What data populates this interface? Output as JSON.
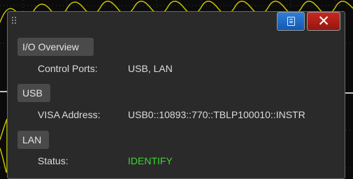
{
  "window": {
    "menu_icon": "menu-icon",
    "close_glyph": "✕",
    "menu_color": "#1f6cc8",
    "close_color": "#b3201a"
  },
  "sections": {
    "io_overview": {
      "title": "I/O Overview",
      "rows": [
        {
          "label": "Control Ports:",
          "value": "USB, LAN"
        }
      ]
    },
    "usb": {
      "title": "USB",
      "rows": [
        {
          "label": "VISA Address:",
          "value": "USB0::10893::770::TBLP100010::INSTR"
        }
      ]
    },
    "lan": {
      "title": "LAN",
      "rows": [
        {
          "label": "Status:",
          "value": "IDENTIFY",
          "value_color": "#3fd433"
        }
      ]
    }
  }
}
